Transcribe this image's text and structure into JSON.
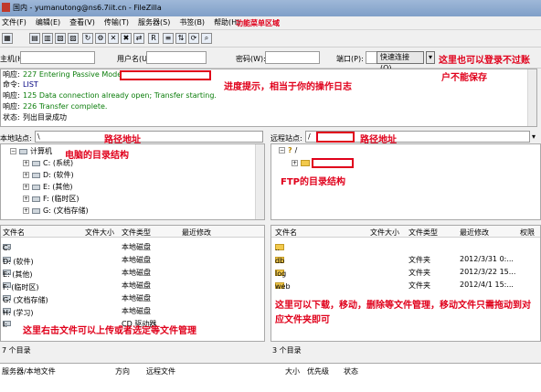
{
  "window": {
    "title": "国内 - yumanutong@ns6.7iit.cn - FileZilla"
  },
  "menu": [
    "文件(F)",
    "编辑(E)",
    "查看(V)",
    "传输(T)",
    "服务器(S)",
    "书签(B)",
    "帮助(H)"
  ],
  "quickconnect": {
    "host_label": "主机(H):",
    "user_label": "用户名(U):",
    "pass_label": "密码(W):",
    "port_label": "端口(P):",
    "button_label": "快速连接(Q)"
  },
  "log": [
    {
      "label": "响应:",
      "text": "227 Entering Passive Mode",
      "color": "#0a7d0a"
    },
    {
      "label": "命令:",
      "text": "LIST",
      "color": "#000080"
    },
    {
      "label": "响应:",
      "text": "125 Data connection already open; Transfer starting.",
      "color": "#0a7d0a"
    },
    {
      "label": "响应:",
      "text": "226 Transfer complete.",
      "color": "#0a7d0a"
    },
    {
      "label": "状态:",
      "text": "列出目录成功",
      "color": "#000000"
    }
  ],
  "local": {
    "site_label": "本地站点:",
    "path": "\\",
    "tree": {
      "root": "计算机",
      "items": [
        "C: (系统)",
        "D: (软件)",
        "E: (其他)",
        "F: (临时区)",
        "G: (文档存储)"
      ]
    },
    "columns": [
      "文件名",
      "文件大小",
      "文件类型",
      "最近修改"
    ],
    "files": [
      {
        "name": "C:",
        "type": "本地磁盘"
      },
      {
        "name": "D: (软件)",
        "type": "本地磁盘"
      },
      {
        "name": "E: (其他)",
        "type": "本地磁盘"
      },
      {
        "name": "F: (临时区)",
        "type": "本地磁盘"
      },
      {
        "name": "G: (文档存储)",
        "type": "本地磁盘"
      },
      {
        "name": "H: (学习)",
        "type": "本地磁盘"
      },
      {
        "name": "I:",
        "type": "CD 驱动器"
      }
    ],
    "status": "7 个目录"
  },
  "remote": {
    "site_label": "远程站点:",
    "path": "/",
    "tree_root": "/",
    "columns": [
      "文件名",
      "文件大小",
      "文件类型",
      "最近修改",
      "权限"
    ],
    "files": [
      {
        "name": "..",
        "type": "",
        "modified": ""
      },
      {
        "name": "db",
        "type": "文件夹",
        "modified": "2012/3/31 0:..."
      },
      {
        "name": "log",
        "type": "文件夹",
        "modified": "2012/3/22 15..."
      },
      {
        "name": "web",
        "type": "文件夹",
        "modified": "2012/4/1 15:..."
      }
    ],
    "status": "3 个目录"
  },
  "queue": {
    "columns": [
      "服务器/本地文件",
      "方向",
      "远程文件",
      "大小",
      "优先级",
      "状态"
    ]
  },
  "annotations": {
    "menu": "功能菜单区域",
    "quick": "这里也可以登录不过账户不能保存",
    "log": "进度提示，相当于你的操作日志",
    "local_path": "路径地址",
    "local_tree": "电脑的目录结构",
    "remote_path": "路径地址",
    "remote_tree": "FTP的目录结构",
    "remote_files": "这里可以下载，移动，删除等文件管理，移动文件只需拖动到对应文件夹即可",
    "local_files": "这里右击文件可以上传或者选定等文件管理"
  },
  "colors": {
    "annotation": "#e0001b",
    "titlebar": "#8aa8d0"
  }
}
